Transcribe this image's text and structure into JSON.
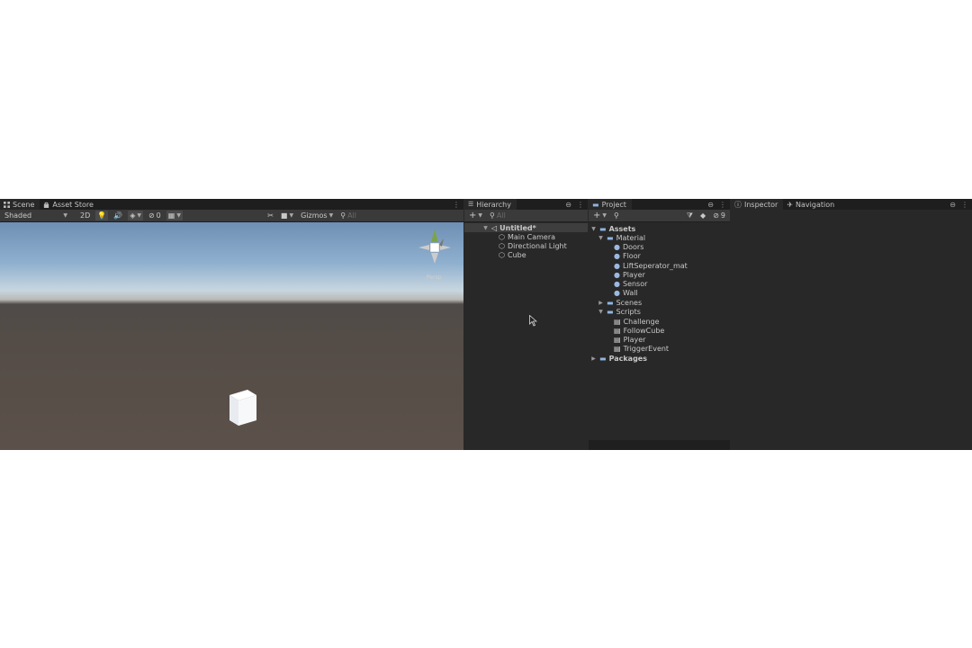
{
  "scene": {
    "tabs": [
      {
        "label": "Scene",
        "icon": "grid-icon",
        "active": true
      },
      {
        "label": "Asset Store",
        "icon": "bag-icon",
        "active": false
      }
    ],
    "toolbar": {
      "shading_mode": "Shaded",
      "mode_2d": "2D",
      "effects_count": "0",
      "gizmos_label": "Gizmos",
      "search_placeholder": "All"
    },
    "gizmo_label": "Persp"
  },
  "hierarchy": {
    "tab_label": "Hierarchy",
    "search_placeholder": "All",
    "scene_name": "Untitled*",
    "items": [
      "Main Camera",
      "Directional Light",
      "Cube"
    ]
  },
  "project": {
    "tab_label": "Project",
    "hidden_count": "9",
    "root": "Assets",
    "folders": {
      "material": {
        "label": "Material",
        "items": [
          "Doors",
          "Floor",
          "LiftSeperator_mat",
          "Player",
          "Sensor",
          "Wall"
        ]
      },
      "scenes": {
        "label": "Scenes"
      },
      "scripts": {
        "label": "Scripts",
        "items": [
          "Challenge",
          "FollowCube",
          "Player",
          "TriggerEvent"
        ]
      }
    },
    "packages": "Packages"
  },
  "inspector": {
    "tabs": [
      {
        "label": "Inspector",
        "icon": "info-icon"
      },
      {
        "label": "Navigation",
        "icon": "navigation-icon"
      }
    ]
  },
  "colors": {
    "panel_bg": "#282828",
    "tabbar_bg": "#1e1e1e",
    "toolbar_bg": "#3a3a3a",
    "folder": "#8fb4e0",
    "accent": "#4b8ddf"
  }
}
